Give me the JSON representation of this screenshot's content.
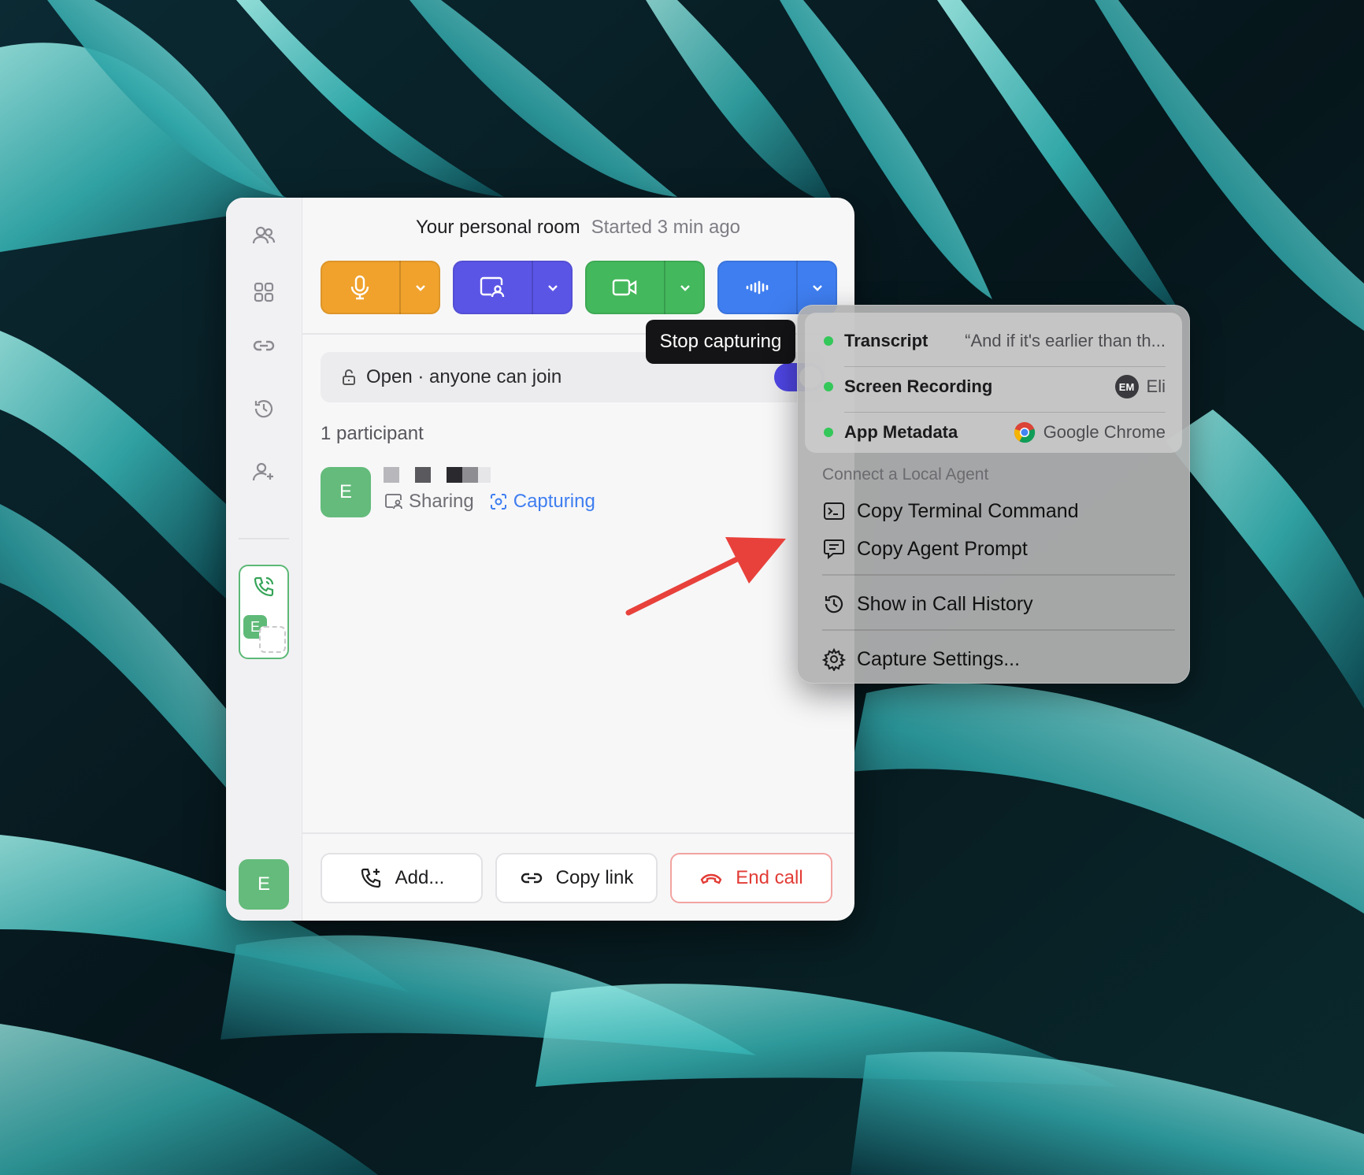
{
  "header": {
    "title": "Your personal room",
    "started": "Started 3 min ago"
  },
  "controls": {
    "mic": {
      "icon": "microphone-icon",
      "color": "#f0a22c"
    },
    "screen_share": {
      "icon": "screen-share-icon",
      "color": "#5b55e6"
    },
    "camera": {
      "icon": "video-camera-icon",
      "color": "#44b85c"
    },
    "capture": {
      "icon": "audio-waveform-icon",
      "color": "#3f7ef0"
    }
  },
  "tooltip": "Stop capturing",
  "access": {
    "label": "Open · anyone can join",
    "toggle_on": true,
    "toggle_color": "#4f46e5"
  },
  "participants": {
    "count_label": "1 participant",
    "list": [
      {
        "avatar_letter": "E",
        "status_sharing": "Sharing",
        "status_capturing": "Capturing"
      }
    ]
  },
  "sidebar": {
    "items": [
      {
        "icon": "people-icon"
      },
      {
        "icon": "grid-icon"
      },
      {
        "icon": "link-icon"
      },
      {
        "icon": "history-icon"
      },
      {
        "icon": "add-person-icon"
      }
    ],
    "active_call_avatar": "E",
    "self_avatar": "E"
  },
  "footer": {
    "add_label": "Add...",
    "copy_link_label": "Copy link",
    "end_call_label": "End call"
  },
  "menu": {
    "status_items": [
      {
        "label": "Transcript",
        "value": "“And if it's earlier than th..."
      },
      {
        "label": "Screen Recording",
        "badge": "EM",
        "value": "Eli"
      },
      {
        "label": "App Metadata",
        "value": "Google Chrome"
      }
    ],
    "section_label": "Connect a Local Agent",
    "copy_terminal": "Copy Terminal Command",
    "copy_prompt": "Copy Agent Prompt",
    "call_history": "Show in Call History",
    "capture_settings": "Capture Settings..."
  },
  "colors": {
    "status_dot": "#34c759",
    "accent_capture": "#3f7ef0",
    "end_call": "#e23c36",
    "avatar": "#64bb7b",
    "annotation_arrow": "#e8413b"
  }
}
